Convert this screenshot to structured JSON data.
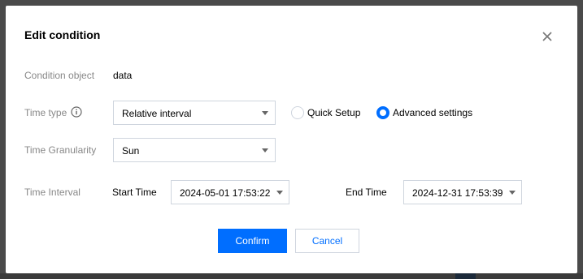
{
  "dialog": {
    "title": "Edit condition",
    "close_icon": "close-icon"
  },
  "form": {
    "condition_object": {
      "label": "Condition object",
      "value": "data"
    },
    "time_type": {
      "label": "Time type",
      "info_icon": "info-icon",
      "selected": "Relative interval",
      "radios": [
        {
          "label": "Quick Setup",
          "checked": false
        },
        {
          "label": "Advanced settings",
          "checked": true
        }
      ]
    },
    "time_granularity": {
      "label": "Time Granularity",
      "selected": "Sun"
    },
    "time_interval": {
      "label": "Time Interval",
      "start_label": "Start Time",
      "start_value": "2024-05-01 17:53:22",
      "end_label": "End Time",
      "end_value": "2024-12-31 17:53:39"
    }
  },
  "actions": {
    "confirm_label": "Confirm",
    "cancel_label": "Cancel"
  },
  "colors": {
    "primary": "#006eff",
    "border": "#cfd5de",
    "label": "#888888"
  }
}
